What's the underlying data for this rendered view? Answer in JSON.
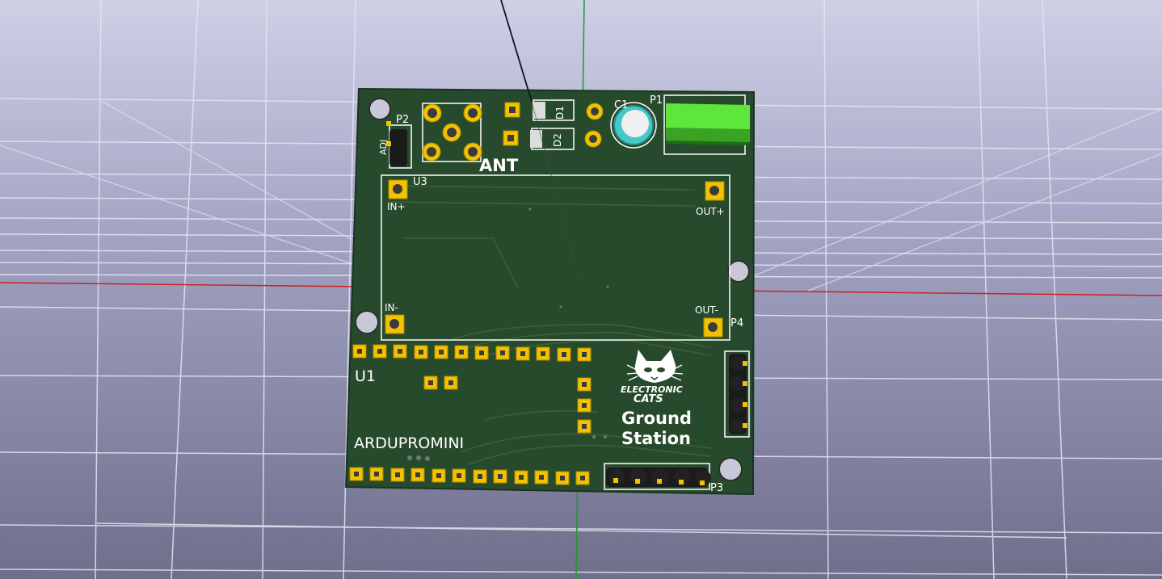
{
  "colors": {
    "board": "#284a2c",
    "silkscreen": "#ffffff",
    "pad": "#f2c200",
    "x_axis": "#cc2222",
    "y_axis": "#1a9a2a",
    "connector_p1": "#5fe63c",
    "capacitor": "#44c8c8"
  },
  "board": {
    "refs": {
      "p2": "P2",
      "adj": "ADJ",
      "ant": "ANT",
      "d1": "D1",
      "d2": "D2",
      "c1": "C1",
      "p1": "P1",
      "u3": "U3",
      "in_plus": "IN+",
      "out_plus": "OUT+",
      "in_minus": "IN-",
      "out_minus": "OUT-",
      "p4": "P4",
      "u1": "U1",
      "ardupromini": "ARDUPROMINI",
      "p3": "P3"
    },
    "logo": {
      "line1": "ELECTRONIC",
      "line2": "CATS"
    },
    "title": {
      "line1": "Ground",
      "line2": "Station"
    }
  }
}
